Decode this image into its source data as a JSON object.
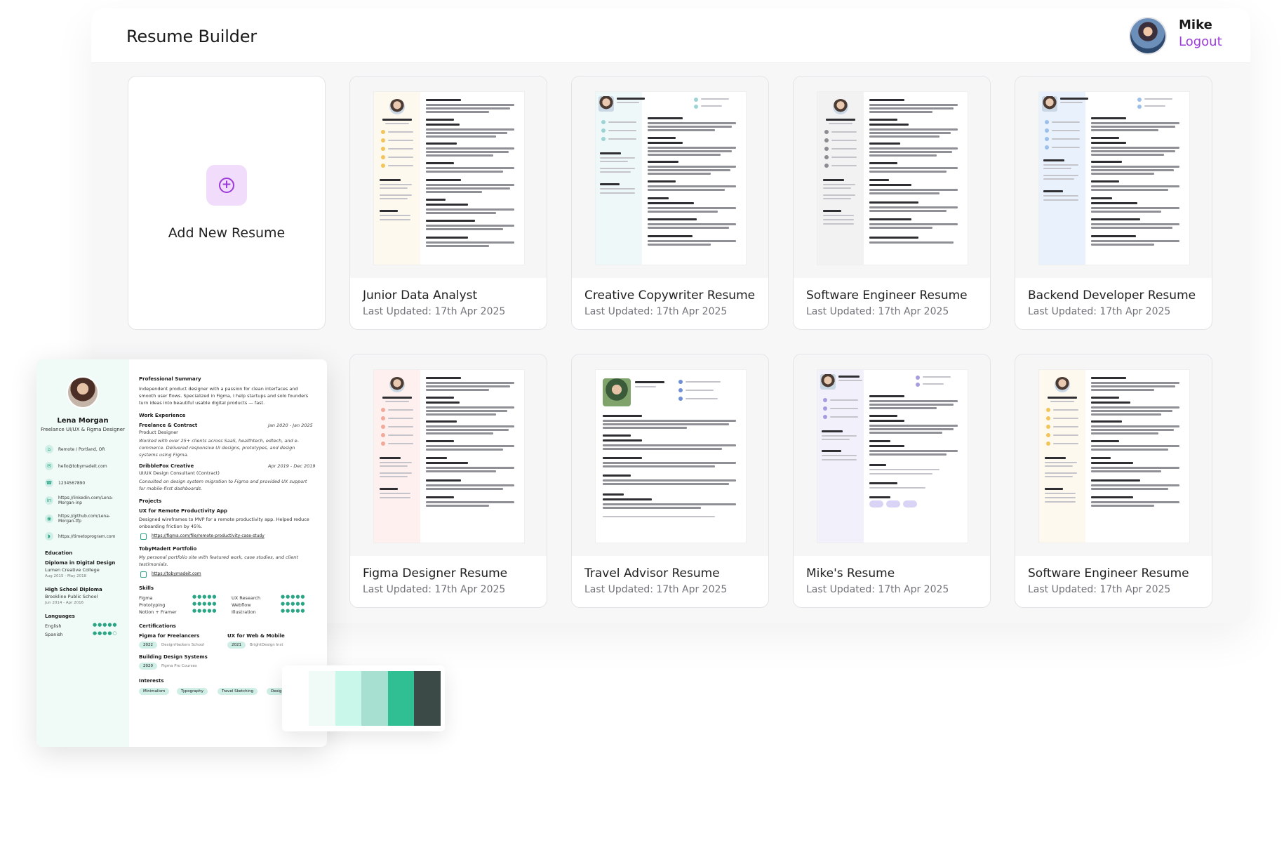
{
  "header": {
    "title": "Resume Builder",
    "user_name": "Mike",
    "logout_label": "Logout"
  },
  "add_card": {
    "label": "Add New Resume"
  },
  "resumes": [
    {
      "title": "Junior Data Analyst",
      "updated": "Last Updated: 17th Apr 2025"
    },
    {
      "title": "Creative Copywriter Resume",
      "updated": "Last Updated: 17th Apr 2025"
    },
    {
      "title": "Software Engineer Resume",
      "updated": "Last Updated: 17th Apr 2025"
    },
    {
      "title": "Backend Developer Resume",
      "updated": "Last Updated: 17th Apr 2025"
    },
    {
      "title": "Figma Designer Resume",
      "updated": "Last Updated: 17th Apr 2025"
    },
    {
      "title": "Travel Advisor Resume",
      "updated": "Last Updated: 17th Apr 2025"
    },
    {
      "title": "Mike's Resume",
      "updated": "Last Updated: 17th Apr 2025"
    },
    {
      "title": "Software Engineer Resume",
      "updated": "Last Updated: 17th Apr 2025"
    }
  ],
  "preview": {
    "name": "Lena Morgan",
    "role": "Freelance UI/UX & Figma Designer",
    "contacts": [
      "Remote / Portland, OR",
      "hello@tobymadeit.com",
      "1234567890",
      "https://linkedin.com/Lena-Morgan-inp",
      "https://github.com/Lena-Morgan-tfp",
      "https://timetoprogram.com"
    ],
    "education_h": "Education",
    "edu1": "Diploma in Digital Design",
    "edu1_school": "Lumen Creative College",
    "edu1_date": "Aug 2015 - May 2018",
    "edu2": "High School Diploma",
    "edu2_school": "Brookline Public School",
    "edu2_date": "Jun 2014 - Apr 2016",
    "languages_h": "Languages",
    "lang1": "English",
    "lang2": "Spanish",
    "summary_h": "Professional Summary",
    "summary1": "Independent product designer with a passion for clean interfaces and",
    "summary2": "smooth user flows. Specialized in Figma, I help startups and solo founders",
    "summary3": "turn ideas into beautiful usable digital products — fast.",
    "work_h": "Work Experience",
    "job1": "Freelance & Contract",
    "job1_date": "Jan 2020 - Jan 2025",
    "job1_role": "Product Designer",
    "job1_d1": "Worked with over 25+ clients across SaaS, healthtech, edtech, and e-",
    "job1_d2": "commerce. Delivered responsive UI designs, prototypes, and design",
    "job1_d3": "systems using Figma.",
    "job2": "DribbleFox Creative",
    "job2_date": "Apr 2019 - Dec 2019",
    "job2_role": "UI/UX Design Consultant (Contract)",
    "job2_d1": "Consulted on design system migration to Figma and provided UX support",
    "job2_d2": "for mobile-first dashboards.",
    "projects_h": "Projects",
    "proj1": "UX for Remote Productivity App",
    "proj1_d1": "Designed wireframes to MVP for a remote productivity app. Helped reduce",
    "proj1_d2": "onboarding friction by 45%.",
    "proj1_link": "https://figma.com/file/remote-productivity-case-study",
    "proj2": "TobyMadeIt Portfolio",
    "proj2_d1": "My personal portfolio site with featured work, case studies, and client",
    "proj2_d2": "testimonials.",
    "proj2_link": "https://tobymadeit.com",
    "skills_h": "Skills",
    "skill1": "Figma",
    "skill2": "Prototyping",
    "skill3": "Notion + Framer",
    "skill4": "UX Research",
    "skill5": "Webflow",
    "skill6": "Illustration",
    "cert_h": "Certifications",
    "cert1": "Figma for Freelancers",
    "cert1_year": "2022",
    "cert1_org": "DesignHackers School",
    "cert2": "UX for Web & Mobile",
    "cert2_year": "2021",
    "cert2_org": "BrightDesign Inst",
    "cert3": "Building Design Systems",
    "cert3_year": "2020",
    "cert3_org": "Figma Pro Courses",
    "interests_h": "Interests",
    "interests": [
      "Minimalism",
      "Typography",
      "Travel Sketching",
      "Design Mentoring"
    ]
  },
  "palette": [
    "#f0fbf8",
    "#c9f7e9",
    "#a7dfd0",
    "#2fbf93",
    "#3c4a47"
  ],
  "accent": "#9b3bd8"
}
